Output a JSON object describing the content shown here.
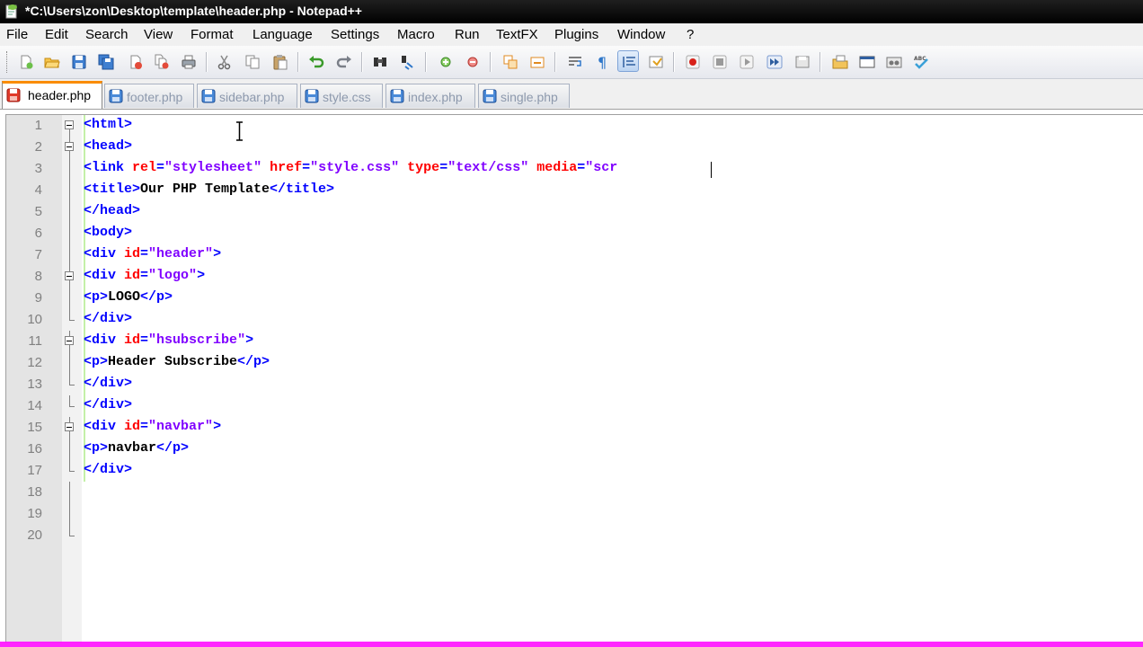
{
  "window": {
    "title": "*C:\\Users\\zon\\Desktop\\template\\header.php - Notepad++"
  },
  "menu": [
    "File",
    "Edit",
    "Search",
    "View",
    "Format",
    "Language",
    "Settings",
    "Macro",
    "Run",
    "TextFX",
    "Plugins",
    "Window",
    "?"
  ],
  "toolbar": {
    "icons": [
      "new-file-icon",
      "open-file-icon",
      "save-icon",
      "save-all-icon",
      "close-icon",
      "close-all-icon",
      "print-icon",
      "cut-icon",
      "copy-icon",
      "paste-icon",
      "undo-icon",
      "redo-icon",
      "find-icon",
      "replace-icon",
      "zoom-in-icon",
      "zoom-out-icon",
      "sync-vertical-icon",
      "sync-horizontal-icon",
      "word-wrap-icon",
      "show-all-chars-icon",
      "indent-guide-icon",
      "user-lang-icon",
      "record-macro-icon",
      "stop-record-icon",
      "play-macro-icon",
      "run-macro-multiple-icon",
      "save-macro-icon",
      "folder-open-icon",
      "launch-browser-icon",
      "compare-icon",
      "spell-check-icon"
    ],
    "active_icon": "indent-guide-icon"
  },
  "tabs": [
    {
      "label": "header.php",
      "active": true
    },
    {
      "label": "footer.php",
      "active": false
    },
    {
      "label": "sidebar.php",
      "active": false
    },
    {
      "label": "style.css",
      "active": false
    },
    {
      "label": "index.php",
      "active": false
    },
    {
      "label": "single.php",
      "active": false
    }
  ],
  "editor": {
    "lines": [
      {
        "n": "1",
        "fold": "box",
        "segs": [
          [
            "t",
            "<html>"
          ]
        ]
      },
      {
        "n": "2",
        "fold": "box",
        "segs": [
          [
            "t",
            "<head>"
          ]
        ]
      },
      {
        "n": "3",
        "fold": "line",
        "segs": [
          [
            "t",
            "<link "
          ],
          [
            "a",
            "rel"
          ],
          [
            "t",
            "="
          ],
          [
            "v",
            "\"stylesheet\""
          ],
          [
            "t",
            " "
          ],
          [
            "a",
            "href"
          ],
          [
            "t",
            "="
          ],
          [
            "v",
            "\"style.css\""
          ],
          [
            "t",
            " "
          ],
          [
            "a",
            "type"
          ],
          [
            "t",
            "="
          ],
          [
            "v",
            "\"text/css\""
          ],
          [
            "t",
            " "
          ],
          [
            "a",
            "media"
          ],
          [
            "t",
            "="
          ],
          [
            "v",
            "\"scr"
          ]
        ]
      },
      {
        "n": "4",
        "fold": "line",
        "segs": [
          [
            "t",
            "<title>"
          ],
          [
            "x",
            "Our PHP Template"
          ],
          [
            "t",
            "</title>"
          ]
        ]
      },
      {
        "n": "5",
        "fold": "line",
        "segs": [
          [
            "t",
            "</head>"
          ]
        ]
      },
      {
        "n": "6",
        "fold": "line",
        "segs": [
          [
            "t",
            "<body>"
          ]
        ]
      },
      {
        "n": "7",
        "fold": "line",
        "segs": [
          [
            "t",
            "<div "
          ],
          [
            "a",
            "id"
          ],
          [
            "t",
            "="
          ],
          [
            "v",
            "\"header\""
          ],
          [
            "t",
            ">"
          ]
        ]
      },
      {
        "n": "8",
        "fold": "box",
        "segs": [
          [
            "t",
            "<div "
          ],
          [
            "a",
            "id"
          ],
          [
            "t",
            "="
          ],
          [
            "v",
            "\"logo\""
          ],
          [
            "t",
            ">"
          ]
        ]
      },
      {
        "n": "9",
        "fold": "line",
        "segs": [
          [
            "t",
            "<p>"
          ],
          [
            "x",
            "LOGO"
          ],
          [
            "t",
            "</p>"
          ]
        ]
      },
      {
        "n": "10",
        "fold": "end",
        "segs": [
          [
            "t",
            "</div>"
          ]
        ]
      },
      {
        "n": "11",
        "fold": "box",
        "segs": [
          [
            "t",
            "<div "
          ],
          [
            "a",
            "id"
          ],
          [
            "t",
            "="
          ],
          [
            "v",
            "\"hsubscribe\""
          ],
          [
            "t",
            ">"
          ]
        ]
      },
      {
        "n": "12",
        "fold": "line",
        "segs": [
          [
            "t",
            "<p>"
          ],
          [
            "x",
            "Header Subscribe"
          ],
          [
            "t",
            "</p>"
          ]
        ]
      },
      {
        "n": "13",
        "fold": "end",
        "segs": [
          [
            "t",
            "</div>"
          ]
        ]
      },
      {
        "n": "14",
        "fold": "end",
        "segs": [
          [
            "t",
            "</div>"
          ]
        ]
      },
      {
        "n": "15",
        "fold": "box",
        "segs": [
          [
            "t",
            "<div "
          ],
          [
            "a",
            "id"
          ],
          [
            "t",
            "="
          ],
          [
            "v",
            "\"navbar\""
          ],
          [
            "t",
            ">"
          ]
        ]
      },
      {
        "n": "16",
        "fold": "line",
        "segs": [
          [
            "t",
            "<p>"
          ],
          [
            "x",
            "navbar"
          ],
          [
            "t",
            "</p>"
          ]
        ]
      },
      {
        "n": "17",
        "fold": "end",
        "segs": [
          [
            "t",
            "</div>"
          ]
        ]
      },
      {
        "n": "18",
        "fold": "line",
        "segs": []
      },
      {
        "n": "19",
        "fold": "line",
        "segs": []
      },
      {
        "n": "20",
        "fold": "end",
        "segs": []
      }
    ]
  },
  "colors": {
    "tag": "#0000ff",
    "attribute": "#ff0000",
    "attribute_value": "#8000ff",
    "text": "#000000",
    "active_tab_accent": "#fa8c00"
  }
}
